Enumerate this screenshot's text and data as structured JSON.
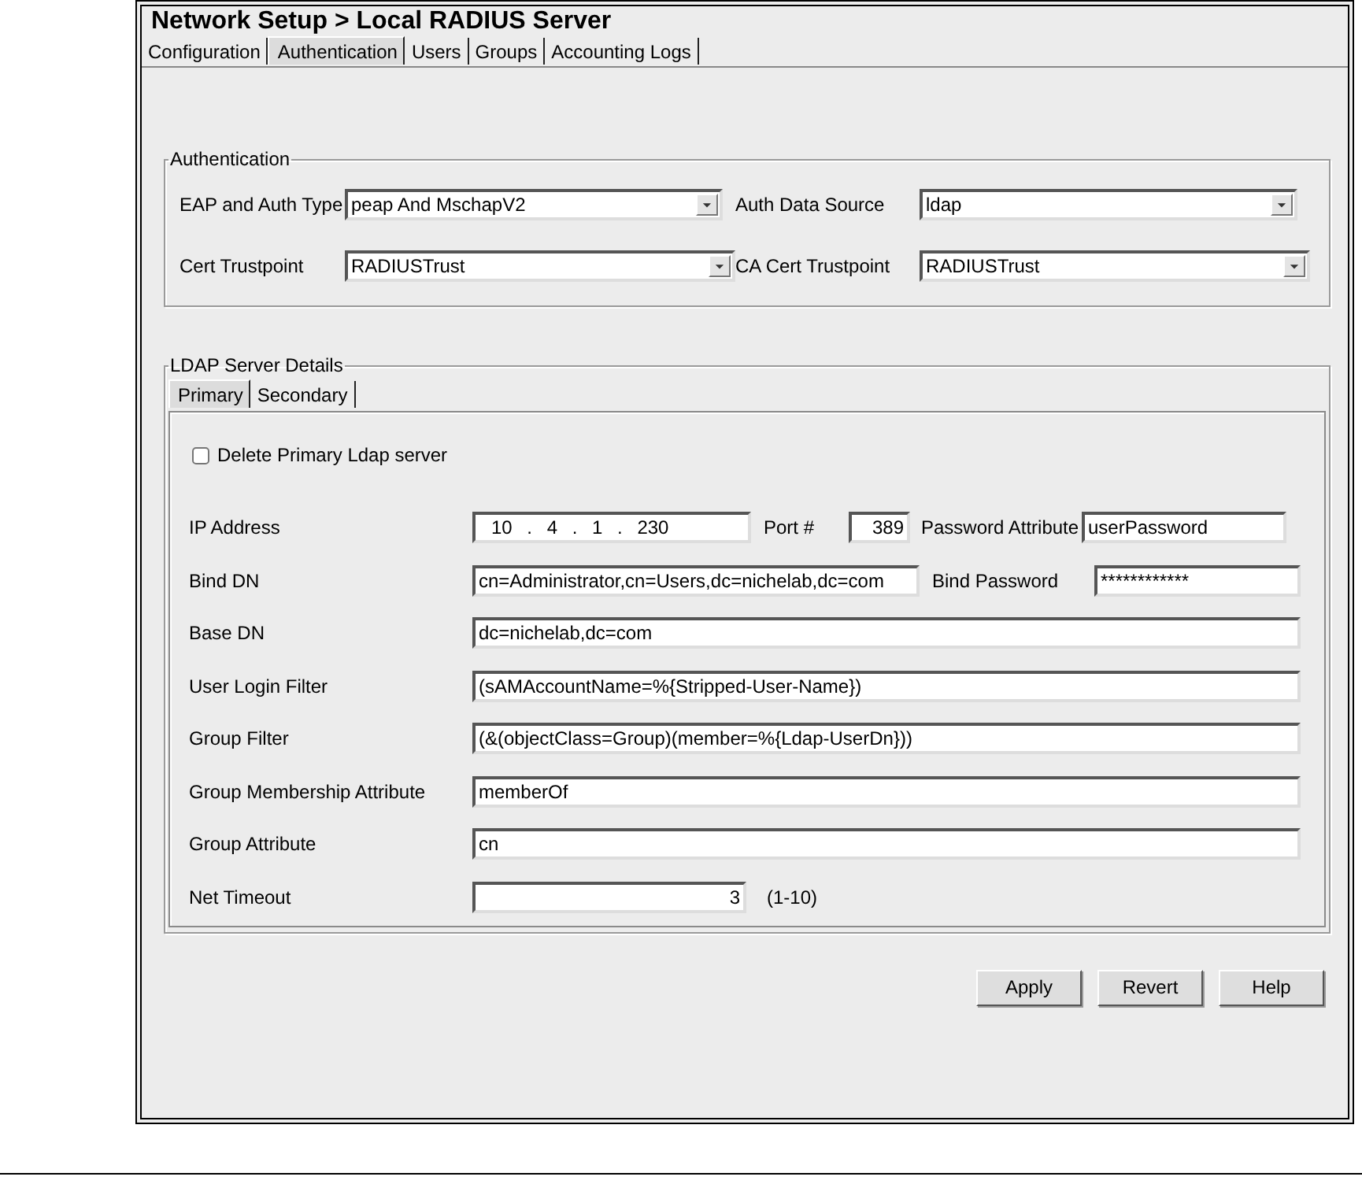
{
  "window": {
    "title": "Network Setup > Local RADIUS Server"
  },
  "tabs": [
    {
      "label": "Configuration",
      "selected": false
    },
    {
      "label": "Authentication",
      "selected": true
    },
    {
      "label": "Users",
      "selected": false
    },
    {
      "label": "Groups",
      "selected": false
    },
    {
      "label": "Accounting Logs",
      "selected": false
    }
  ],
  "authentication": {
    "title": "Authentication",
    "fields": [
      {
        "label": "EAP and Auth Type",
        "value": "peap And MschapV2"
      },
      {
        "label": "Auth Data Source",
        "value": "ldap"
      },
      {
        "label": "Cert Trustpoint",
        "value": "RADIUSTrust"
      },
      {
        "label": "CA Cert Trustpoint",
        "value": "RADIUSTrust"
      }
    ]
  },
  "ldap": {
    "title": "LDAP Server Details",
    "tabs": [
      {
        "label": "Primary",
        "selected": true
      },
      {
        "label": "Secondary",
        "selected": false
      }
    ],
    "delete_checkbox": {
      "label": "Delete Primary Ldap server",
      "checked": false
    },
    "rows": [
      {
        "label": "IP Address",
        "kind": "ip",
        "value": "10 . 4 . 1 . 230",
        "extras": [
          {
            "label": "Port #",
            "kind": "number",
            "value": "389"
          },
          {
            "label": "Password Attribute",
            "kind": "text",
            "value": "userPassword"
          }
        ]
      },
      {
        "label": "Bind DN",
        "kind": "text",
        "value": "cn=Administrator,cn=Users,dc=nichelab,dc=com",
        "extras": [
          {
            "label": "Bind Password",
            "kind": "password",
            "value": "************"
          }
        ]
      },
      {
        "label": "Base DN",
        "kind": "text",
        "value": "dc=nichelab,dc=com"
      },
      {
        "label": "User Login Filter",
        "kind": "text",
        "value": "(sAMAccountName=%{Stripped-User-Name})"
      },
      {
        "label": "Group Filter",
        "kind": "text",
        "value": "(&(objectClass=Group)(member=%{Ldap-UserDn}))"
      },
      {
        "label": "Group Membership Attribute",
        "kind": "text",
        "value": "memberOf"
      },
      {
        "label": "Group Attribute",
        "kind": "text",
        "value": "cn"
      },
      {
        "label": "Net Timeout",
        "kind": "number",
        "value": "3",
        "hint": "(1-10)"
      }
    ]
  },
  "buttons": [
    "Apply",
    "Revert",
    "Help"
  ]
}
